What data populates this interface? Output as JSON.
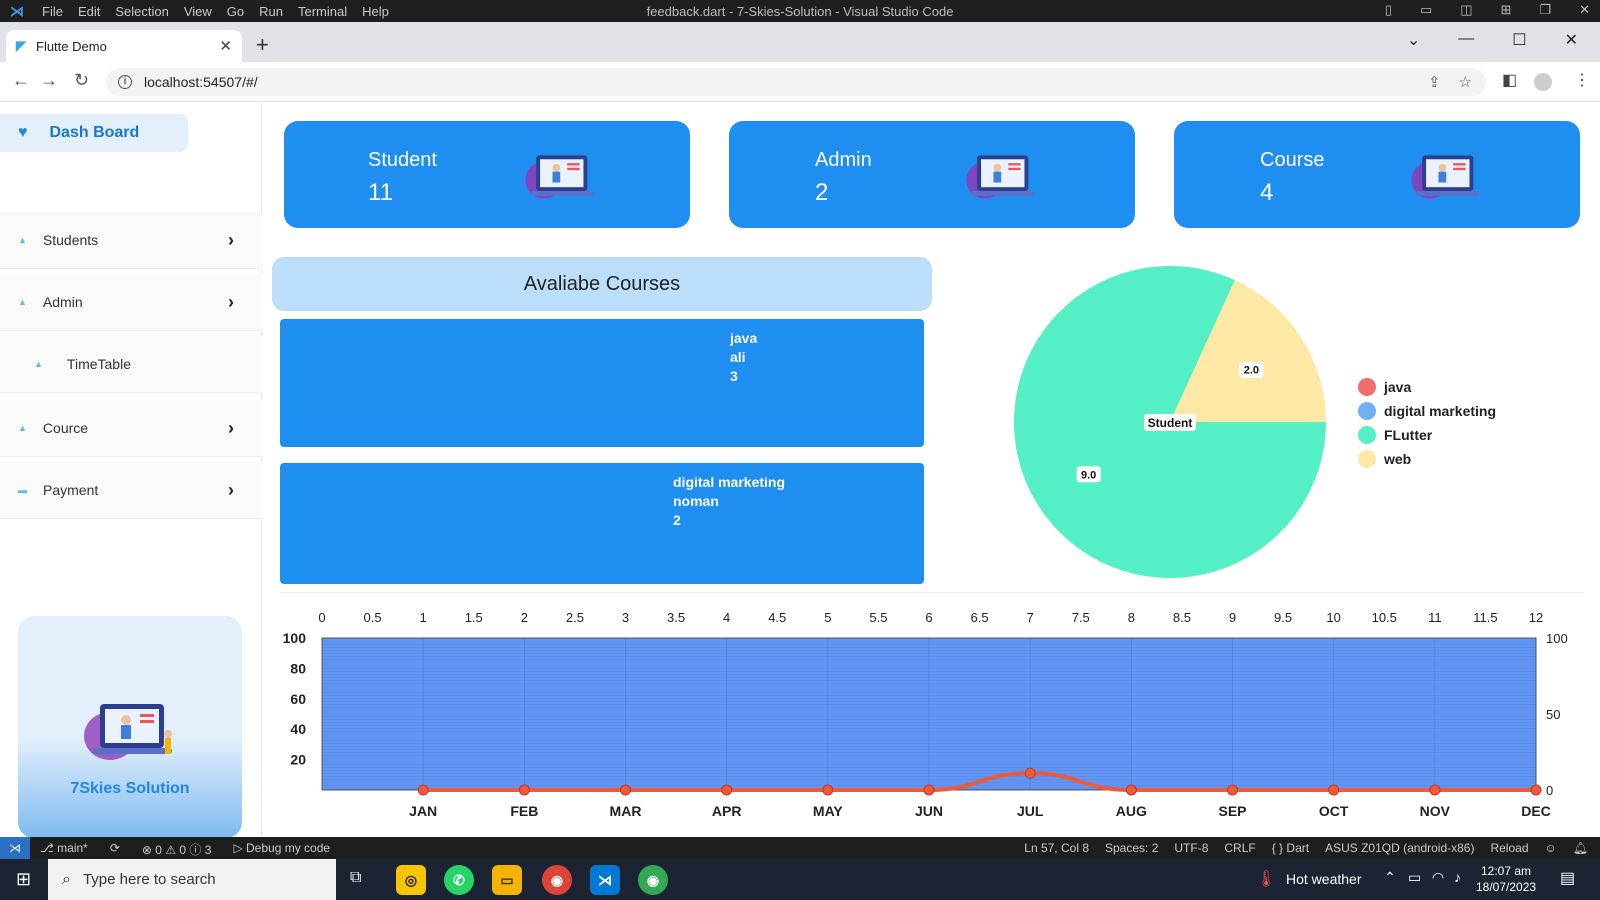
{
  "vscode": {
    "menu": [
      "File",
      "Edit",
      "Selection",
      "View",
      "Go",
      "Run",
      "Terminal",
      "Help"
    ],
    "title": "feedback.dart - 7-Skies-Solution - Visual Studio Code"
  },
  "browser": {
    "tab_title": "Flutte Demo",
    "url": "localhost:54507/#/"
  },
  "sidebar": {
    "dashboard_label": "Dash Board",
    "items": [
      {
        "label": "Students",
        "has_chevron": true
      },
      {
        "label": "Admin",
        "has_chevron": true
      },
      {
        "label": "TimeTable",
        "has_chevron": false
      },
      {
        "label": "Cource",
        "has_chevron": true
      },
      {
        "label": "Payment",
        "has_chevron": true
      }
    ],
    "brand": "7Skies Solution"
  },
  "stats": [
    {
      "label": "Student",
      "value": "11"
    },
    {
      "label": "Admin",
      "value": "2"
    },
    {
      "label": "Course",
      "value": "4"
    }
  ],
  "courses": {
    "heading": "Avaliabe Courses",
    "items": [
      {
        "name": "java",
        "teacher": "ali",
        "count": "3"
      },
      {
        "name": "digital marketing",
        "teacher": "noman",
        "count": "2"
      }
    ]
  },
  "chart_data": [
    {
      "type": "pie",
      "title": "",
      "center_label": "Student",
      "slices": [
        {
          "name": "java",
          "value": 0,
          "color": "#f26d6d"
        },
        {
          "name": "digital marketing",
          "value": 0,
          "color": "#6fb1f5"
        },
        {
          "name": "FLutter",
          "value": 9.0,
          "color": "#54efc4"
        },
        {
          "name": "web",
          "value": 2.0,
          "color": "#fde8a6"
        }
      ],
      "data_labels": [
        "9.0",
        "2.0"
      ],
      "legend_position": "right"
    },
    {
      "type": "line",
      "top_axis_ticks": [
        "0",
        "0.5",
        "1",
        "1.5",
        "2",
        "2.5",
        "3",
        "3.5",
        "4",
        "4.5",
        "5",
        "5.5",
        "6",
        "6.5",
        "7",
        "7.5",
        "8",
        "8.5",
        "9",
        "9.5",
        "10",
        "10.5",
        "11",
        "11.5",
        "12"
      ],
      "left_axis_ticks": [
        "100",
        "80",
        "60",
        "40",
        "20"
      ],
      "right_axis_ticks": [
        "100",
        "50",
        "0"
      ],
      "categories": [
        "JAN",
        "FEB",
        "MAR",
        "APR",
        "MAY",
        "JUN",
        "JUL",
        "AUG",
        "SEP",
        "OCT",
        "NOV",
        "DEC"
      ],
      "x": [
        1,
        2,
        3,
        4,
        5,
        6,
        7,
        8,
        9,
        10,
        11,
        12
      ],
      "values": [
        0,
        0,
        0,
        0,
        0,
        0,
        11,
        0,
        0,
        0,
        0,
        0
      ],
      "ylim": [
        0,
        100
      ],
      "xlim": [
        0,
        12
      ],
      "area_color": "#5a8ff0",
      "line_color": "#ee5a3a",
      "grid": true
    }
  ],
  "statusbar": {
    "branch": "main*",
    "problems": "⊗ 0 ⚠ 0 ⓘ 3",
    "debug": "Debug my code",
    "position": "Ln 57, Col 8",
    "spaces": "Spaces: 2",
    "encoding": "UTF-8",
    "eol": "CRLF",
    "language": "{ } Dart",
    "device": "ASUS Z01QD (android-x86)",
    "reload": "Reload"
  },
  "taskbar": {
    "search_placeholder": "Type here to search",
    "weather": "Hot weather",
    "time": "12:07 am",
    "date": "18/07/2023"
  }
}
